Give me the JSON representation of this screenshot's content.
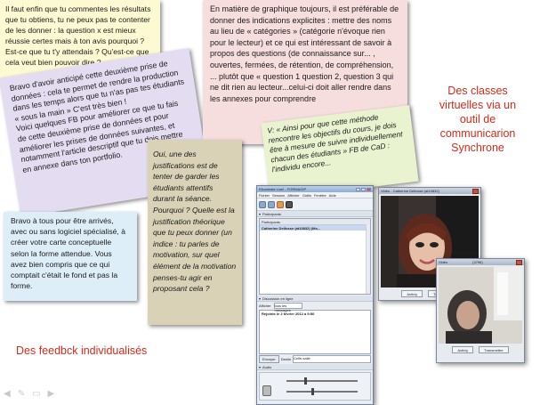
{
  "notes": {
    "yellow": "Il faut enfin que tu commentes les résultats que tu obtiens, tu ne peux pas te contenter de les donner : la question x est mieux réussie certes mais à ton avis pourquoi ? Est-ce que tu t'y attendais ? Qu'est-ce que cela veut bien pouvoir dire ?...",
    "lavender": "Bravo d'avoir anticipé cette deuxième prise de données : cela te permet de rendre la production dans les temps alors que tu n'as pas tes étudiants « sous la main » C'est très bien !\nVoici quelques FB pour améliorer ce que tu fais de cette deuxième prise de données et pour améliorer les prises de données suivantes, et notamment l'article descriptif que tu dois mettre en annexe dans ton portfolio.",
    "pink": "En matière de graphique toujours, il est préférable de donner des indications explicites : mettre des noms au lieu de « catégories » (catégorie n'évoque rien pour le lecteur) et ce qui est intéressant de savoir à propos des questions (de connaissance sur... , ouvertes, fermées, de rétention, de compréhension, ... plutôt que « question 1 question 2, question 3 qui ne dit rien au lecteur...celui-ci doit aller rendre dans les annexes pour comprendre",
    "green": "V: « Ainsi pour que cette méthode rencontre les objectifs du cours, je dois être à mesure de suivre individuellement chacun des étudiants » FB de CaD : l'individu encore...",
    "tan": "Oui, une des justifications est de tenter de garder les étudiants attentifs durant la séance. Pourquoi ? Quelle est la justification théorique que tu peux donner (un indice : tu parles de motivation, sur quel élément de la motivation penses-tu agir en proposant cela ?",
    "blue": "Bravo à tous pour être arrivés, avec ou sans logiciel spécialisé, à créer votre carte conceptuelle selon la forme attendue. Vous avez bien compris que ce qui comptait c'était le fond et pas la forme."
  },
  "captions": {
    "right": "Des classes\nvirtuelles via un\noutil de\ncommunicarion\nSynchrone",
    "bottom": "Des feedbck individualisés"
  },
  "app": {
    "title": "Elluminate Live! - FORMAGIP",
    "menu": [
      "Fichier",
      "Session",
      "Afficher",
      "Outils",
      "Fenêtre",
      "Aide"
    ],
    "participants_section": "Participants",
    "participants_header": "Participants",
    "participant_row": "Catherine Delfosse (at10832) (Mo...",
    "chat_section": "Discussion en ligne",
    "chat_filter_label": "Afficher",
    "chat_filter_value": "tous les messages",
    "chat_log_entry": "Rejointe le 2 février 2012 à 9:50",
    "send_button": "Envoyer",
    "recipient_label": "Destin",
    "recipient_value": "Celle-salle",
    "audio_section": "Audio"
  },
  "video1": {
    "title": "Vidéo - Catherine Delfosse (at10832)",
    "btn1": "Activ/y",
    "btn2": "Transmettre"
  },
  "video2": {
    "title": "Vidéo",
    "id_label": "(3796)",
    "btn1": "Activ/y",
    "btn2": "Transmettre"
  },
  "colors": {
    "caption_red": "#d42a1a",
    "yellow_note": "#fdfad3",
    "lavender_note": "#e4dcf0",
    "pink_note": "#f7dede",
    "green_note": "#e9f3d0",
    "tan_note": "#d9d2b7",
    "blue_note": "#ddeef8"
  }
}
